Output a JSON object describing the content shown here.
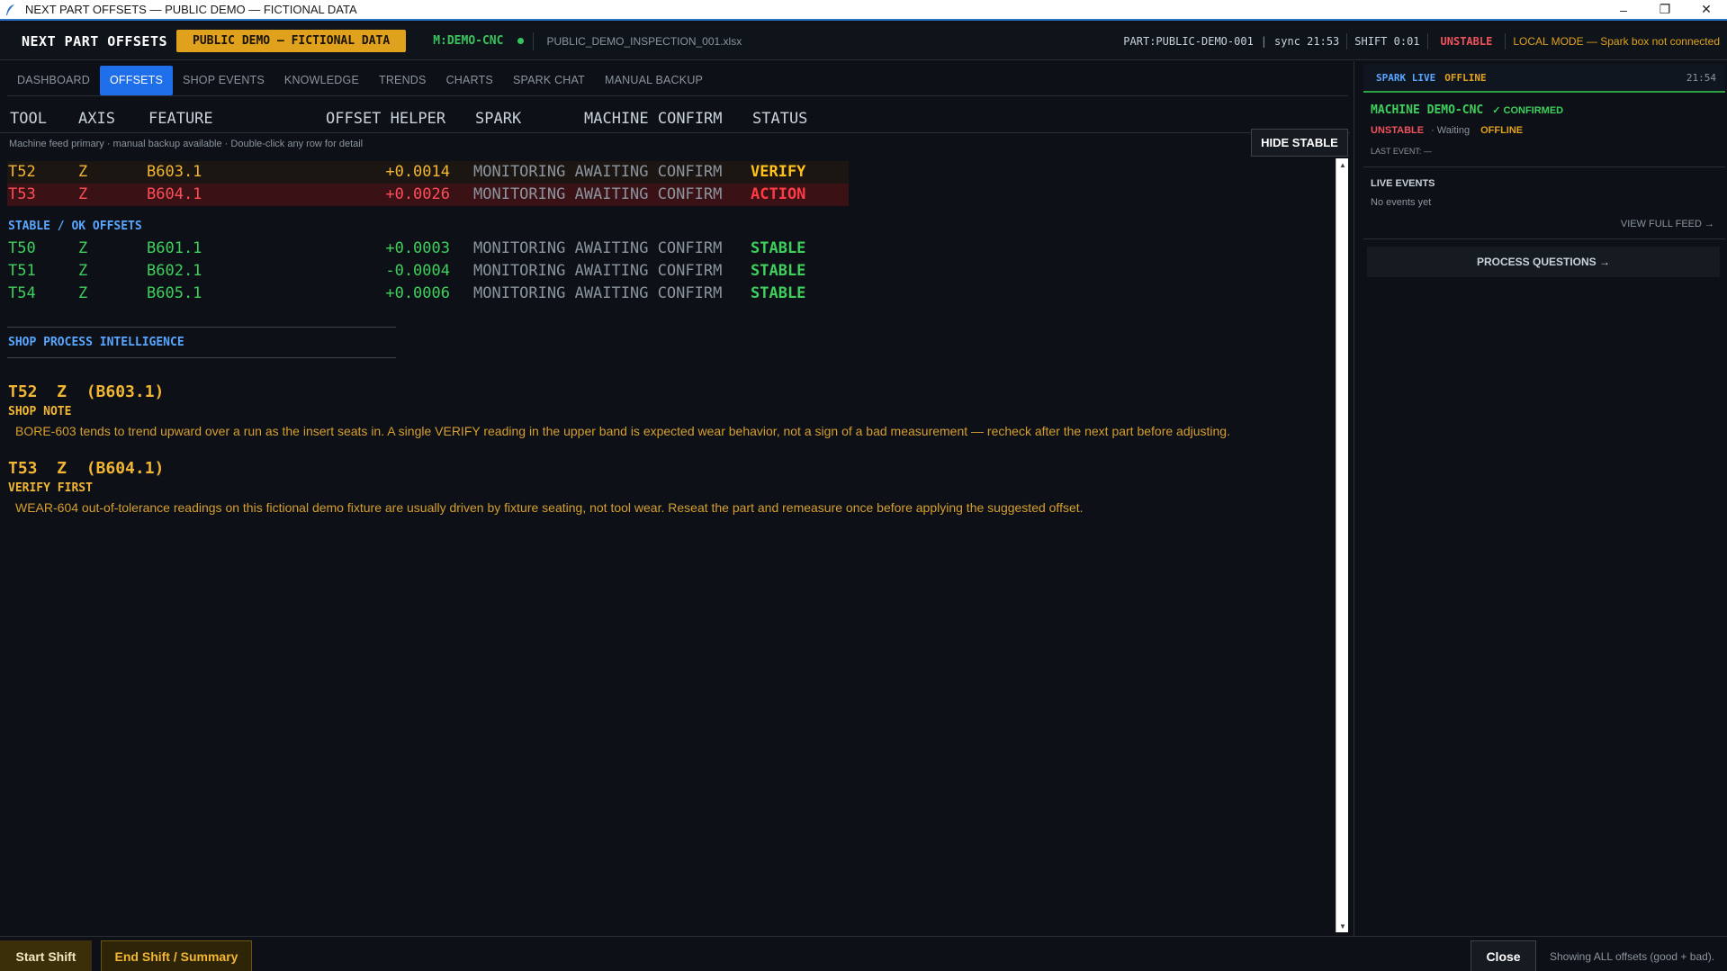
{
  "window": {
    "title": "NEXT PART OFFSETS — PUBLIC DEMO — FICTIONAL DATA",
    "controls": [
      "minimize-icon",
      "restore-icon",
      "close-icon"
    ]
  },
  "header": {
    "app_name": "NEXT PART OFFSETS",
    "demo_badge": "PUBLIC DEMO — FICTIONAL DATA",
    "machine": "M:DEMO-CNC",
    "file": "PUBLIC_DEMO_INSPECTION_001.xlsx",
    "part": "PART:PUBLIC-DEMO-001",
    "pipe": "|",
    "sync": "sync 21:53",
    "shift": "SHIFT 0:01",
    "status": "UNSTABLE",
    "mode": "LOCAL MODE — Spark box not connected"
  },
  "nav": {
    "tabs": [
      {
        "label": "DASHBOARD",
        "active": false
      },
      {
        "label": "OFFSETS",
        "active": true
      },
      {
        "label": "SHOP EVENTS",
        "active": false
      },
      {
        "label": "KNOWLEDGE",
        "active": false
      },
      {
        "label": "TRENDS",
        "active": false
      },
      {
        "label": "CHARTS",
        "active": false
      },
      {
        "label": "SPARK CHAT",
        "active": false
      },
      {
        "label": "MANUAL BACKUP",
        "active": false
      }
    ]
  },
  "columns": {
    "tool": "TOOL",
    "axis": "AXIS",
    "feature": "FEATURE",
    "offset_helper": "OFFSET HELPER",
    "spark": "SPARK",
    "machine_confirm": "MACHINE CONFIRM",
    "status": "STATUS"
  },
  "hint": "Machine feed primary · manual backup available · Double-click any row for detail",
  "hide_stable_label": "HIDE STABLE",
  "attention_rows": [
    {
      "tool": "T52",
      "axis": "Z",
      "feature": "B603.1",
      "offset": "+0.0014",
      "spark": "MONITORING AWAITING CONFIRM",
      "status": "VERIFY"
    },
    {
      "tool": "T53",
      "axis": "Z",
      "feature": "B604.1",
      "offset": "+0.0026",
      "spark": "MONITORING AWAITING CONFIRM",
      "status": "ACTION"
    }
  ],
  "stable_section_label": "STABLE / OK OFFSETS",
  "stable_rows": [
    {
      "tool": "T50",
      "axis": "Z",
      "feature": "B601.1",
      "offset": "+0.0003",
      "spark": "MONITORING AWAITING CONFIRM",
      "status": "STABLE"
    },
    {
      "tool": "T51",
      "axis": "Z",
      "feature": "B602.1",
      "offset": "-0.0004",
      "spark": "MONITORING AWAITING CONFIRM",
      "status": "STABLE"
    },
    {
      "tool": "T54",
      "axis": "Z",
      "feature": "B605.1",
      "offset": "+0.0006",
      "spark": "MONITORING AWAITING CONFIRM",
      "status": "STABLE"
    }
  ],
  "intelligence": {
    "label": "SHOP PROCESS INTELLIGENCE",
    "notes": [
      {
        "title": "T52  Z  (B603.1)",
        "subtitle": "SHOP NOTE",
        "body": "BORE-603 tends to trend upward over a run as the insert seats in. A single VERIFY reading in the upper band is expected wear behavior, not a sign of a bad measurement — recheck after the next part before adjusting."
      },
      {
        "title": "T53  Z  (B604.1)",
        "subtitle": "VERIFY FIRST",
        "body": "WEAR-604 out-of-tolerance readings on this fictional demo fixture are usually driven by fixture seating, not tool wear. Reseat the part and remeasure once before applying the suggested offset."
      }
    ]
  },
  "spark_panel": {
    "live_label": "SPARK LIVE",
    "offline_label": "OFFLINE",
    "time": "21:54",
    "machine_name": "MACHINE DEMO-CNC",
    "confirmed": "✓ CONFIRMED",
    "status": "UNSTABLE",
    "waiting": "· Waiting",
    "offline": "OFFLINE",
    "last_event": "LAST EVENT:   —",
    "live_events_title": "LIVE EVENTS",
    "no_events": "No events yet",
    "view_feed": "VIEW FULL FEED →",
    "process_questions": "PROCESS QUESTIONS →"
  },
  "footer": {
    "start_shift": "Start Shift",
    "end_shift": "End Shift / Summary",
    "close": "Close",
    "status": "Showing ALL offsets (good + bad)."
  },
  "colors": {
    "accent_blue": "#1f6feb",
    "demo_badge": "#e0a21c",
    "verify": "#ffc21a",
    "action": "#ff3b44",
    "stable": "#3fcf5c"
  }
}
